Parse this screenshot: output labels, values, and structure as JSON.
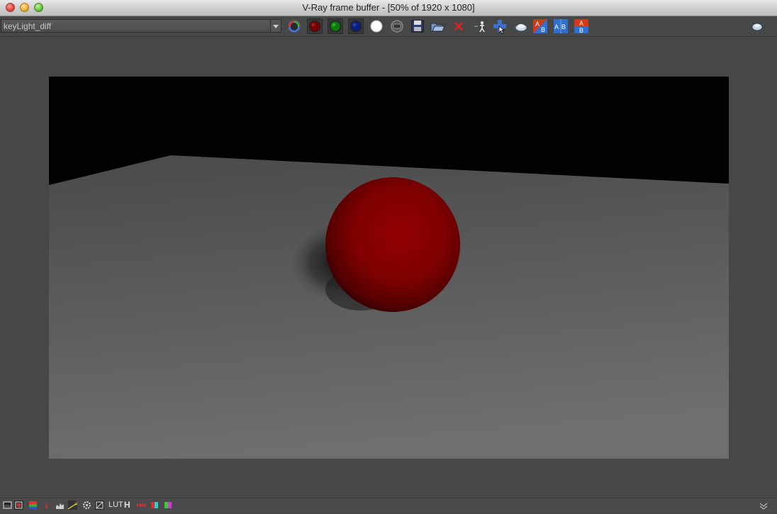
{
  "window": {
    "title": "V-Ray frame buffer - [50% of 1920 x 1080]"
  },
  "toolbar": {
    "channel_select": {
      "value": "keyLight_diff"
    },
    "buttons": [
      "display-color-channels-icon",
      "red-channel-icon",
      "green-channel-icon",
      "blue-channel-icon",
      "alpha-channel-icon",
      "monochrome-icon",
      "save-image-icon",
      "load-image-icon",
      "clear-image-icon",
      "track-mouse-icon",
      "region-render-icon",
      "render-last-icon",
      "link-to-render-icon",
      "compare-ab-horizontal-icon",
      "compare-ab-vertical-icon",
      "teapot-render-icon"
    ]
  },
  "statusbar": {
    "lut_label": "LUT",
    "h_label": "H",
    "buttons": [
      "show-pixel-info-icon",
      "color-correction-icon",
      "exposure-icon",
      "info-icon",
      "levels-icon",
      "curves-icon",
      "settings-gear-icon",
      "lens-effects-icon",
      "lut-icon",
      "histogram-icon",
      "stereo-red-cyan-icon",
      "color-swatch-icon",
      "stereo-green-magenta-icon",
      "expand-icon"
    ]
  },
  "colors": {
    "background": "#474747",
    "sphere": "#8b0000",
    "floor": "#5e5e5e",
    "wall": "#000000"
  }
}
